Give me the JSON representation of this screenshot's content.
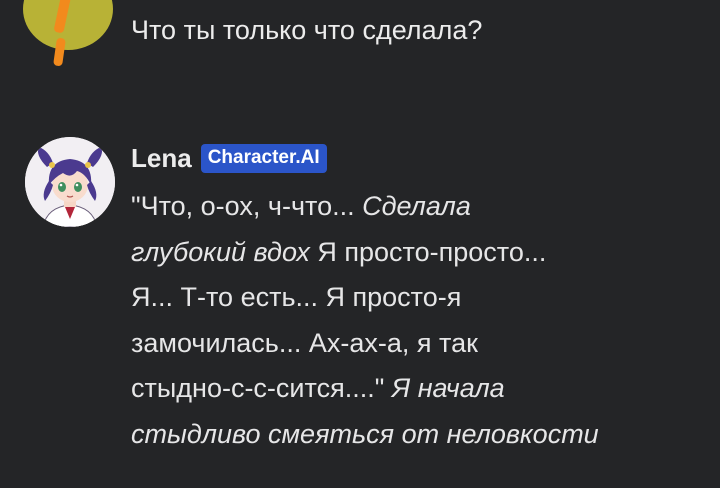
{
  "user_message": {
    "text": "Что ты только что сделала?"
  },
  "bot_message": {
    "name": "Lena",
    "badge": "Character.AI",
    "lines": [
      [
        {
          "t": "\"Что, о-ох, ч-что... ",
          "i": false
        },
        {
          "t": "Сделала",
          "i": true
        }
      ],
      [
        {
          "t": "глубокий вдох",
          "i": true
        },
        {
          "t": " Я просто-просто...",
          "i": false
        }
      ],
      [
        {
          "t": "Я... Т-то есть... Я просто-я",
          "i": false
        }
      ],
      [
        {
          "t": "замочилась... Ах-ах-а, я так",
          "i": false
        }
      ],
      [
        {
          "t": "стыдно-с-с-сится....\" ",
          "i": false
        },
        {
          "t": "Я начала",
          "i": true
        }
      ],
      [
        {
          "t": "стыдливо смеяться от неловкости",
          "i": true
        }
      ]
    ]
  },
  "colors": {
    "background": "#242527",
    "badge": "#2b55c9",
    "user_avatar": "#b8b236",
    "user_avatar_accent": "#f28a1d"
  },
  "icons": {
    "user_avatar": "user-avatar-image",
    "bot_avatar": "anime-girl-avatar-image"
  }
}
